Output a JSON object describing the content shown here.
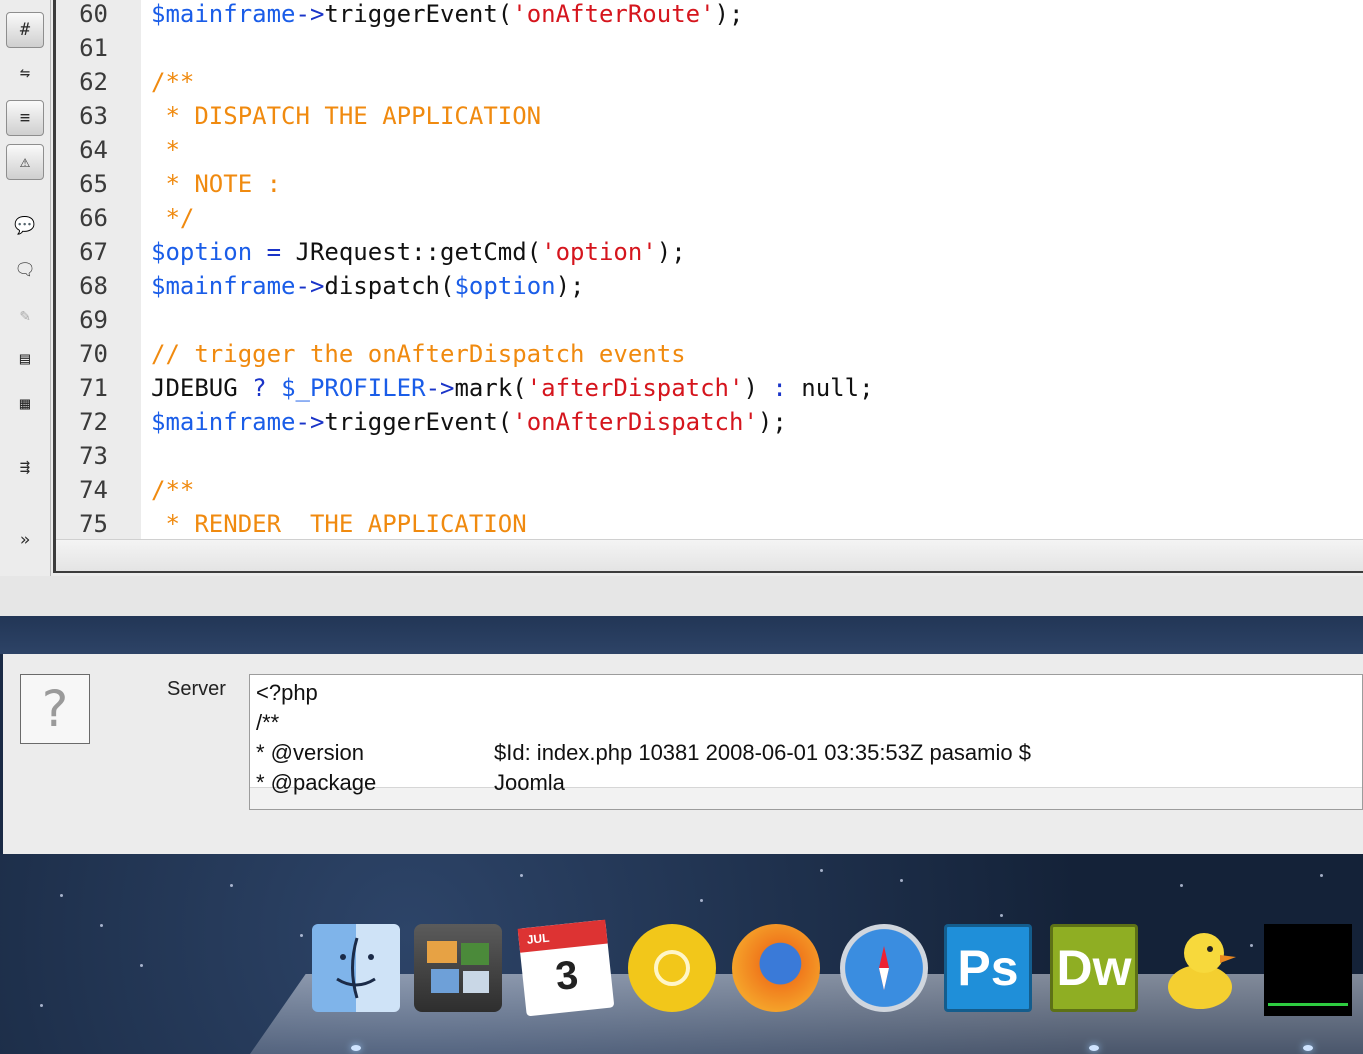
{
  "editor": {
    "lines": [
      {
        "n": "60",
        "tokens": [
          [
            "var",
            "$mainframe"
          ],
          [
            "op",
            "->"
          ],
          [
            "def",
            "triggerEvent("
          ],
          [
            "str",
            "'onAfterRoute'"
          ],
          [
            "def",
            ");"
          ]
        ]
      },
      {
        "n": "61",
        "tokens": []
      },
      {
        "n": "62",
        "tokens": [
          [
            "com",
            "/**"
          ]
        ]
      },
      {
        "n": "63",
        "tokens": [
          [
            "com",
            " * DISPATCH THE APPLICATION"
          ]
        ]
      },
      {
        "n": "64",
        "tokens": [
          [
            "com",
            " *"
          ]
        ]
      },
      {
        "n": "65",
        "tokens": [
          [
            "com",
            " * NOTE :"
          ]
        ]
      },
      {
        "n": "66",
        "tokens": [
          [
            "com",
            " */"
          ]
        ]
      },
      {
        "n": "67",
        "tokens": [
          [
            "var",
            "$option"
          ],
          [
            "def",
            " "
          ],
          [
            "op",
            "="
          ],
          [
            "def",
            " JRequest::getCmd("
          ],
          [
            "str",
            "'option'"
          ],
          [
            "def",
            ");"
          ]
        ]
      },
      {
        "n": "68",
        "tokens": [
          [
            "var",
            "$mainframe"
          ],
          [
            "op",
            "->"
          ],
          [
            "def",
            "dispatch("
          ],
          [
            "var",
            "$option"
          ],
          [
            "def",
            ");"
          ]
        ]
      },
      {
        "n": "69",
        "tokens": []
      },
      {
        "n": "70",
        "tokens": [
          [
            "com",
            "// trigger the onAfterDispatch events"
          ]
        ]
      },
      {
        "n": "71",
        "tokens": [
          [
            "def",
            "JDEBUG "
          ],
          [
            "op",
            "?"
          ],
          [
            "def",
            " "
          ],
          [
            "var",
            "$_PROFILER"
          ],
          [
            "op",
            "->"
          ],
          [
            "def",
            "mark("
          ],
          [
            "str",
            "'afterDispatch'"
          ],
          [
            "def",
            ") "
          ],
          [
            "op",
            ":"
          ],
          [
            "def",
            " null;"
          ]
        ]
      },
      {
        "n": "72",
        "tokens": [
          [
            "var",
            "$mainframe"
          ],
          [
            "op",
            "->"
          ],
          [
            "def",
            "triggerEvent("
          ],
          [
            "str",
            "'onAfterDispatch'"
          ],
          [
            "def",
            ");"
          ]
        ]
      },
      {
        "n": "73",
        "tokens": []
      },
      {
        "n": "74",
        "tokens": [
          [
            "com",
            "/**"
          ]
        ]
      },
      {
        "n": "75",
        "tokens": [
          [
            "com",
            " * RENDER  THE APPLICATION"
          ]
        ]
      }
    ]
  },
  "toolbar": {
    "buttons": [
      {
        "name": "line-numbers-icon",
        "glyph": "#",
        "state": "on"
      },
      {
        "name": "highlight-invalid-code-icon",
        "glyph": "⇋",
        "state": "normal"
      },
      {
        "name": "word-wrap-icon",
        "glyph": "≡",
        "state": "on"
      },
      {
        "name": "syntax-warning-icon",
        "glyph": "⚠",
        "state": "on"
      },
      {
        "name": "apply-comment-icon",
        "glyph": "💬",
        "state": "normal"
      },
      {
        "name": "remove-comment-icon",
        "glyph": "🗨",
        "state": "normal"
      },
      {
        "name": "wrap-tag-icon",
        "glyph": "✎",
        "state": "dim"
      },
      {
        "name": "recent-snippets-icon",
        "glyph": "▤",
        "state": "normal"
      },
      {
        "name": "move-css-icon",
        "glyph": "▦",
        "state": "normal"
      },
      {
        "name": "indent-code-icon",
        "glyph": "⇶",
        "state": "normal"
      },
      {
        "name": "more-tools-icon",
        "glyph": "»",
        "state": "normal"
      }
    ]
  },
  "info_panel": {
    "icon": "?",
    "label": "Server",
    "lines": [
      {
        "key": "<?php",
        "val": ""
      },
      {
        "key": "/**",
        "val": ""
      },
      {
        "key": "* @version",
        "val": "$Id: index.php 10381 2008-06-01 03:35:53Z pasamio $"
      },
      {
        "key": "* @package",
        "val": "Joomla"
      }
    ]
  },
  "dock": {
    "items": [
      {
        "name": "finder-dock-icon",
        "label": "",
        "running": true
      },
      {
        "name": "iphoto-dock-icon",
        "label": "",
        "running": false
      },
      {
        "name": "ical-dock-icon",
        "label": "3",
        "month": "JUL",
        "running": false
      },
      {
        "name": "chrome-dock-icon",
        "label": "",
        "running": false
      },
      {
        "name": "firefox-dock-icon",
        "label": "",
        "running": false
      },
      {
        "name": "safari-dock-icon",
        "label": "",
        "running": false
      },
      {
        "name": "photoshop-dock-icon",
        "label": "Ps",
        "running": false
      },
      {
        "name": "dreamweaver-dock-icon",
        "label": "Dw",
        "running": true
      },
      {
        "name": "cyberduck-dock-icon",
        "label": "",
        "running": false
      },
      {
        "name": "activity-monitor-dock-icon",
        "label": "",
        "running": true
      }
    ],
    "colors": {
      "ps": "#1f8fd9",
      "dw": "#8fae23",
      "chrome": "#f2c71a"
    }
  }
}
